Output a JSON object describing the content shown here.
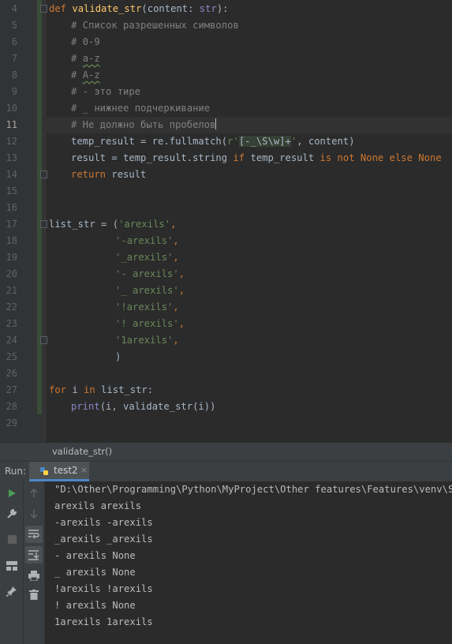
{
  "editor": {
    "line_numbers": [
      "4",
      "5",
      "6",
      "7",
      "8",
      "9",
      "10",
      "11",
      "12",
      "13",
      "14",
      "15",
      "16",
      "17",
      "18",
      "19",
      "20",
      "21",
      "22",
      "23",
      "24",
      "25",
      "26",
      "27",
      "28",
      "29"
    ],
    "current_line": "11",
    "code": {
      "l4": {
        "def": "def",
        "fname": "validate_str",
        "p1": "(content: ",
        "type": "str",
        "p2": "):"
      },
      "l5": "# Список разрешенных символов",
      "l6": "# 0-9",
      "l7_a": "# ",
      "l7_b": "a-z",
      "l8_a": "# ",
      "l8_b": "A-z",
      "l9": "# - это тире",
      "l10": "# _ нижнее подчеркивание",
      "l11": "# Не должно быть пробелов",
      "l12": {
        "a": "temp_result = re.fullmatch(",
        "r": "r'",
        "rx": "[-_\\S\\w]+",
        "q": "'",
        "b": ", content)"
      },
      "l13": {
        "a": "result = temp_result.string ",
        "if": "if",
        "b": " temp_result ",
        "isnot": "is not",
        "sp": " ",
        "none1": "None",
        "sp2": " ",
        "else": "else",
        "sp3": " ",
        "none2": "None"
      },
      "l14": {
        "ret": "return",
        "b": " result"
      },
      "l17": {
        "a": "list_str = (",
        "s": "'arexils'",
        "c": ","
      },
      "l18": {
        "s": "'-arexils'",
        "c": ","
      },
      "l19": {
        "s": "'_arexils'",
        "c": ","
      },
      "l20": {
        "s": "'- arexils'",
        "c": ","
      },
      "l21": {
        "s": "'_ arexils'",
        "c": ","
      },
      "l22": {
        "s": "'!arexils'",
        "c": ","
      },
      "l23": {
        "s": "'! arexils'",
        "c": ","
      },
      "l24": {
        "s": "'1arexils'",
        "c": ","
      },
      "l25": ")",
      "l27": {
        "for": "for",
        "b": " i ",
        "in": "in",
        "c": " list_str:"
      },
      "l28": {
        "print": "print",
        "b": "(i, validate_str(i))"
      }
    }
  },
  "breadcrumb": "validate_str()",
  "run": {
    "label": "Run:",
    "tab_name": "test2",
    "tab_close": "×"
  },
  "console": {
    "lines": [
      "\"D:\\Other\\Programming\\Python\\MyProject\\Other features\\Features\\venv\\Scripts\\python.exe\"",
      "arexils arexils",
      "-arexils -arexils",
      "_arexils _arexils",
      "- arexils None",
      "_ arexils None",
      "!arexils !arexils",
      "! arexils None",
      "1arexils 1arexils"
    ]
  },
  "icons": [
    "run-icon",
    "wrench-icon",
    "stop-icon",
    "layout-icon",
    "pin-icon",
    "up-arrow-icon",
    "down-arrow-icon",
    "soft-wrap-icon",
    "scroll-to-end-icon",
    "print-icon",
    "trash-icon",
    "python-file-icon",
    "close-icon"
  ],
  "colors": {
    "keyword": "#cc7832",
    "function": "#ffc66d",
    "comment": "#808080",
    "string": "#6a8759",
    "builtin": "#8888c6",
    "run_green": "#499c54"
  }
}
